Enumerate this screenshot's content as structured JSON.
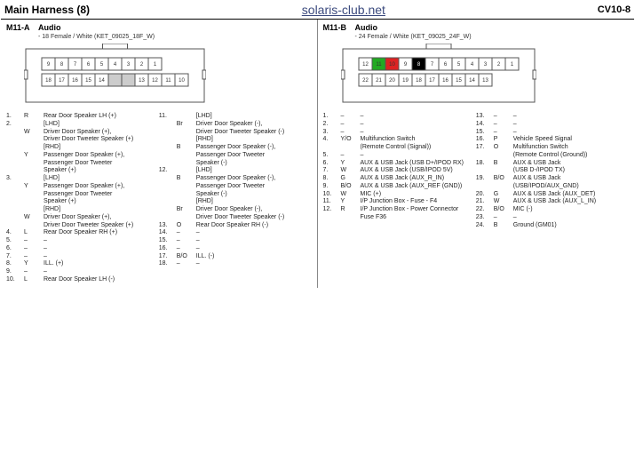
{
  "header": {
    "title": "Main Harness (8)",
    "site": "solaris-club.net",
    "code": "CV10-8"
  },
  "left": {
    "cid": "M11-A",
    "ctitle": "Audio",
    "sub": "- 18 Female / White (KET_09025_18F_W)",
    "top_pins": [
      "9",
      "8",
      "7",
      "6",
      "5",
      "4",
      "3",
      "2",
      "1"
    ],
    "bot_pins": [
      "18",
      "17",
      "16",
      "15",
      "14",
      "",
      "",
      "13",
      "12",
      "11",
      "10"
    ],
    "colA": [
      {
        "n": "1.",
        "c": "R",
        "d": "Rear Door Speaker LH (+)"
      },
      {
        "n": "2.",
        "c": "",
        "d": "[LHD]"
      },
      {
        "n": "",
        "c": "W",
        "d": "Driver Door Speaker (+),"
      },
      {
        "n": "",
        "c": "",
        "d": "Driver Door Tweeter Speaker (+)"
      },
      {
        "n": "",
        "c": "",
        "d": "[RHD]"
      },
      {
        "n": "",
        "c": "Y",
        "d": "Passenger Door Speaker (+),"
      },
      {
        "n": "",
        "c": "",
        "d": "Passenger Door Tweeter"
      },
      {
        "n": "",
        "c": "",
        "d": "Speaker (+)"
      },
      {
        "n": "3.",
        "c": "",
        "d": "[LHD]"
      },
      {
        "n": "",
        "c": "Y",
        "d": "Passenger Door Speaker (+),"
      },
      {
        "n": "",
        "c": "",
        "d": "Passenger Door Tweeter"
      },
      {
        "n": "",
        "c": "",
        "d": "Speaker (+)"
      },
      {
        "n": "",
        "c": "",
        "d": "[RHD]"
      },
      {
        "n": "",
        "c": "W",
        "d": "Driver Door Speaker (+),"
      },
      {
        "n": "",
        "c": "",
        "d": "Driver Door Tweeter Speaker (+)"
      },
      {
        "n": "4.",
        "c": "L",
        "d": "Rear Door Speaker RH (+)"
      },
      {
        "n": "5.",
        "c": "–",
        "d": "–"
      },
      {
        "n": "6.",
        "c": "–",
        "d": "–"
      },
      {
        "n": "7.",
        "c": "–",
        "d": "–"
      },
      {
        "n": "8.",
        "c": "Y",
        "d": "ILL. (+)"
      },
      {
        "n": "9.",
        "c": "–",
        "d": "–"
      },
      {
        "n": "10.",
        "c": "L",
        "d": "Rear Door Speaker LH (-)"
      }
    ],
    "colB": [
      {
        "n": "11.",
        "c": "",
        "d": "[LHD]"
      },
      {
        "n": "",
        "c": "Br",
        "d": "Driver Door Speaker (-),"
      },
      {
        "n": "",
        "c": "",
        "d": "Driver Door Tweeter Speaker (-)"
      },
      {
        "n": "",
        "c": "",
        "d": "[RHD]"
      },
      {
        "n": "",
        "c": "B",
        "d": "Passenger Door Speaker (-),"
      },
      {
        "n": "",
        "c": "",
        "d": "Passenger Door Tweeter"
      },
      {
        "n": "",
        "c": "",
        "d": "Speaker (-)"
      },
      {
        "n": "12.",
        "c": "",
        "d": "[LHD]"
      },
      {
        "n": "",
        "c": "B",
        "d": "Passenger Door Speaker (-),"
      },
      {
        "n": "",
        "c": "",
        "d": "Passenger Door Tweeter"
      },
      {
        "n": "",
        "c": "",
        "d": "Speaker (-)"
      },
      {
        "n": "",
        "c": "",
        "d": "[RHD]"
      },
      {
        "n": "",
        "c": "Br",
        "d": "Driver Door Speaker (-),"
      },
      {
        "n": "",
        "c": "",
        "d": "Driver Door Tweeter Speaker (-)"
      },
      {
        "n": "13.",
        "c": "O",
        "d": "Rear Door Speaker RH (-)"
      },
      {
        "n": "14.",
        "c": "–",
        "d": "–"
      },
      {
        "n": "15.",
        "c": "–",
        "d": "–"
      },
      {
        "n": "16.",
        "c": "–",
        "d": "–"
      },
      {
        "n": "17.",
        "c": "B/O",
        "d": "ILL. (-)"
      },
      {
        "n": "18.",
        "c": "–",
        "d": "–"
      }
    ]
  },
  "right": {
    "cid": "M11-B",
    "ctitle": "Audio",
    "sub": "- 24 Female / White (KET_09025_24F_W)",
    "top_pins": [
      "12",
      "11",
      "10",
      "9",
      "8",
      "7",
      "6",
      "5",
      "4",
      "3",
      "2",
      "1"
    ],
    "top_fill": {
      "8": "black",
      "9": "white",
      "10": "red",
      "11": "green"
    },
    "bot_pins": [
      "22",
      "21",
      "20",
      "19",
      "18",
      "17",
      "16",
      "15",
      "14",
      "13"
    ],
    "colA": [
      {
        "n": "1.",
        "c": "–",
        "d": "–"
      },
      {
        "n": "2.",
        "c": "–",
        "d": "–"
      },
      {
        "n": "3.",
        "c": "–",
        "d": "–"
      },
      {
        "n": "4.",
        "c": "Y/O",
        "d": "Multifunction Switch"
      },
      {
        "n": "",
        "c": "",
        "d": "(Remote Control (Signal))"
      },
      {
        "n": "5.",
        "c": "–",
        "d": "–"
      },
      {
        "n": "6.",
        "c": "Y",
        "d": "AUX & USB Jack (USB D+/IPOD RX)"
      },
      {
        "n": "7.",
        "c": "W",
        "d": "AUX & USB Jack (USB/IPOD 5V)"
      },
      {
        "n": "8.",
        "c": "G",
        "d": "AUX & USB Jack (AUX_R_IN)"
      },
      {
        "n": "9.",
        "c": "B/O",
        "d": "AUX & USB Jack (AUX_REF (GND))"
      },
      {
        "n": "10.",
        "c": "W",
        "d": "MIC (+)"
      },
      {
        "n": "11.",
        "c": "Y",
        "d": "I/P Junction Box - Fuse - F4"
      },
      {
        "n": "12.",
        "c": "R",
        "d": "I/P Junction Box - Power Connector"
      },
      {
        "n": "",
        "c": "",
        "d": "Fuse F36"
      }
    ],
    "colB": [
      {
        "n": "13.",
        "c": "–",
        "d": "–"
      },
      {
        "n": "14.",
        "c": "–",
        "d": "–"
      },
      {
        "n": "15.",
        "c": "–",
        "d": "–"
      },
      {
        "n": "16.",
        "c": "P",
        "d": "Vehicle Speed Signal"
      },
      {
        "n": "17.",
        "c": "O",
        "d": "Multifunction Switch"
      },
      {
        "n": "",
        "c": "",
        "d": "(Remote Control (Ground))"
      },
      {
        "n": "18.",
        "c": "B",
        "d": "AUX & USB Jack"
      },
      {
        "n": "",
        "c": "",
        "d": "(USB D-/IPOD TX)"
      },
      {
        "n": "19.",
        "c": "B/O",
        "d": "AUX & USB Jack"
      },
      {
        "n": "",
        "c": "",
        "d": "(USB/IPOD/AUX_GND)"
      },
      {
        "n": "20.",
        "c": "G",
        "d": "AUX & USB Jack (AUX_DET)"
      },
      {
        "n": "21.",
        "c": "W",
        "d": "AUX & USB Jack (AUX_L_IN)"
      },
      {
        "n": "22.",
        "c": "B/O",
        "d": "MIC (-)"
      },
      {
        "n": "23.",
        "c": "–",
        "d": "–"
      },
      {
        "n": "24.",
        "c": "B",
        "d": "Ground (GM01)"
      }
    ]
  }
}
